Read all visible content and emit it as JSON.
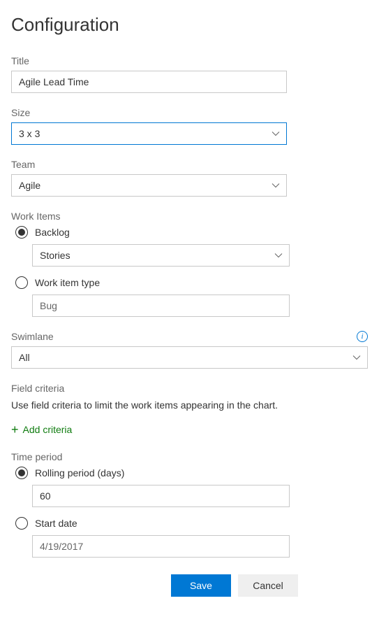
{
  "header": {
    "title": "Configuration"
  },
  "title_field": {
    "label": "Title",
    "value": "Agile Lead Time"
  },
  "size_field": {
    "label": "Size",
    "value": "3 x 3"
  },
  "team_field": {
    "label": "Team",
    "value": "Agile"
  },
  "work_items": {
    "label": "Work Items",
    "backlog": {
      "label": "Backlog",
      "value": "Stories"
    },
    "wit": {
      "label": "Work item type",
      "value": "Bug"
    }
  },
  "swimlane": {
    "label": "Swimlane",
    "value": "All"
  },
  "field_criteria": {
    "heading": "Field criteria",
    "helper": "Use field criteria to limit the work items appearing in the chart.",
    "add_label": "Add criteria"
  },
  "time_period": {
    "label": "Time period",
    "rolling": {
      "label": "Rolling period (days)",
      "value": "60"
    },
    "start": {
      "label": "Start date",
      "value": "4/19/2017"
    }
  },
  "buttons": {
    "save": "Save",
    "cancel": "Cancel"
  }
}
